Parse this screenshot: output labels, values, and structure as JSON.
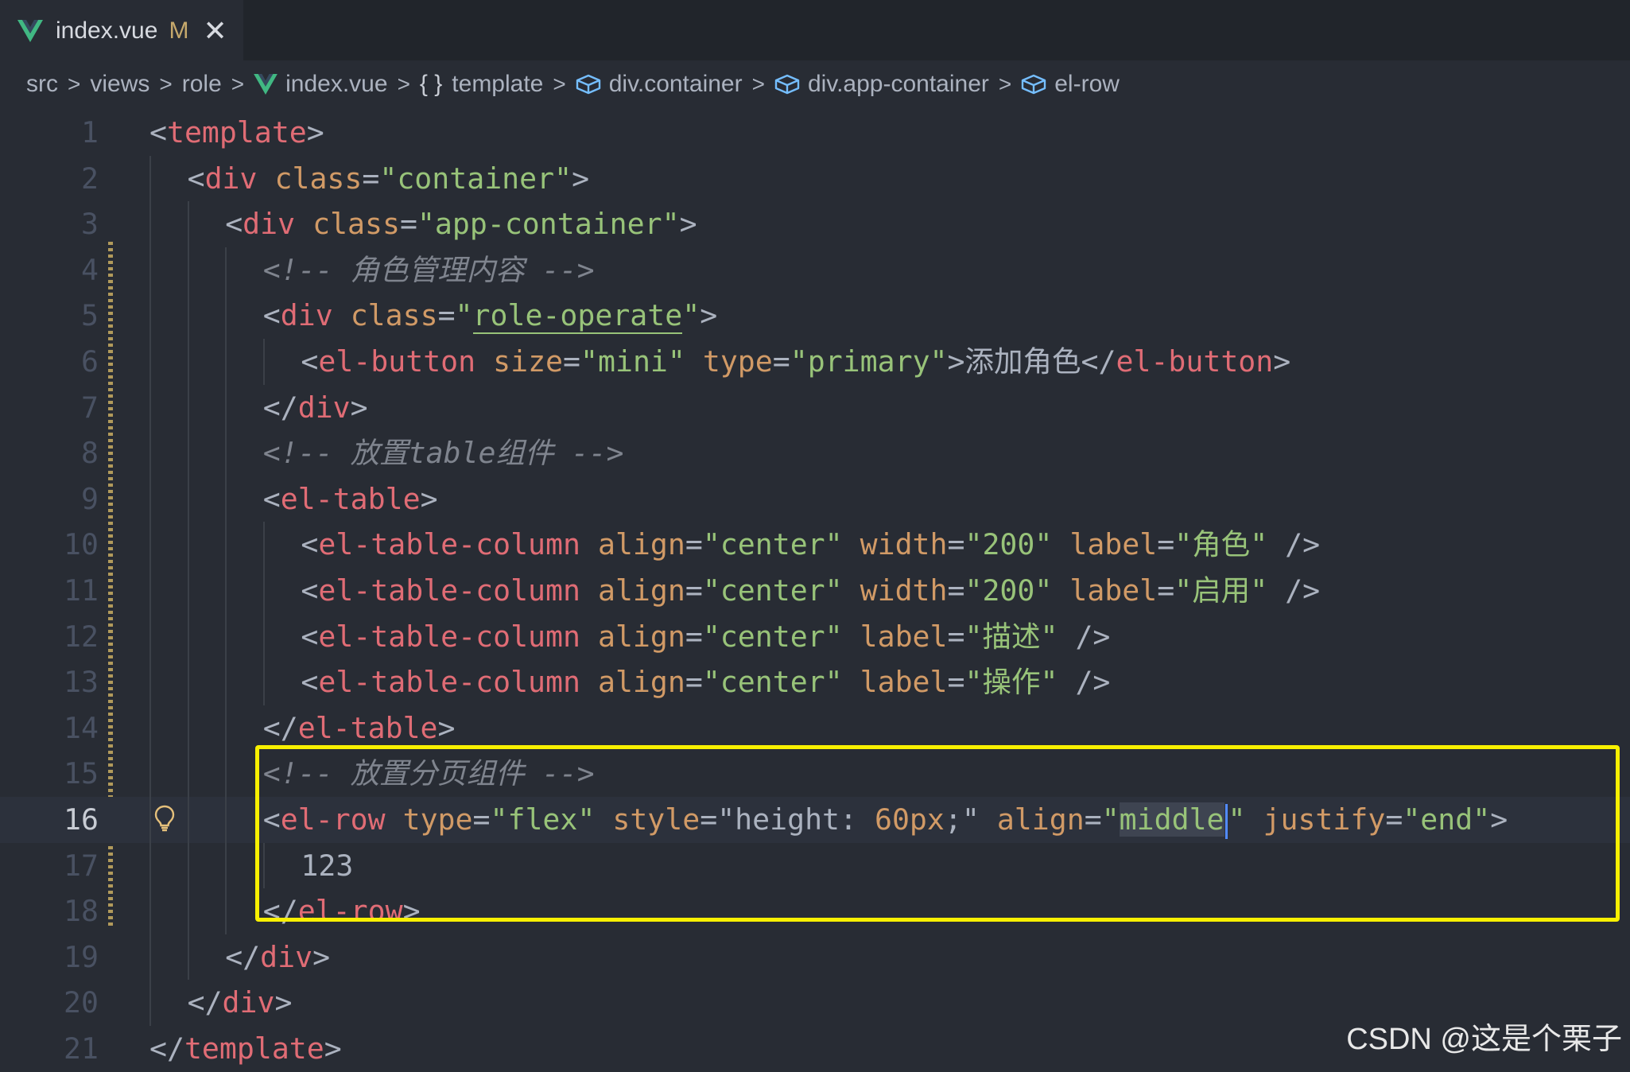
{
  "tab": {
    "filename": "index.vue",
    "modified": "M",
    "close": "✕"
  },
  "breadcrumb": [
    "src",
    "views",
    "role",
    "index.vue",
    "template",
    "div.container",
    "div.app-container",
    "el-row"
  ],
  "editor": {
    "current_line": 16,
    "line_numbers": [
      "1",
      "2",
      "3",
      "4",
      "5",
      "6",
      "7",
      "8",
      "9",
      "10",
      "11",
      "12",
      "13",
      "14",
      "15",
      "16",
      "17",
      "18",
      "19",
      "20",
      "21"
    ],
    "comments": {
      "role_content": "<!-- 角色管理内容 -->",
      "table_component": "<!-- 放置table组件 -->",
      "pagination_component": "<!-- 放置分页组件 -->"
    },
    "button_text": "添加角色",
    "labels": [
      "角色",
      "启用",
      "描述",
      "操作"
    ],
    "row_content": "123"
  },
  "watermark": "CSDN @这是个栗子",
  "colors": {
    "tag": "#e06c75",
    "attr": "#d19a66",
    "string": "#98c379",
    "comment": "#7f848e",
    "highlight": "#f8f000"
  }
}
